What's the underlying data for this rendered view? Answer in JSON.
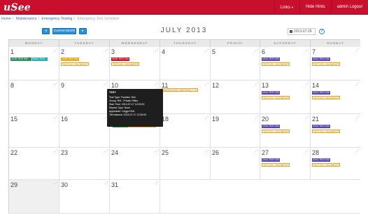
{
  "app": {
    "logo": "uSee"
  },
  "topnav": {
    "links_label": "Links",
    "hide_hints_label": "Hide Hints",
    "user_label": "admin Logout"
  },
  "breadcrumb": {
    "home": "Home",
    "maintenance": "Maintenance",
    "emergency_testing": "Emergency Testing",
    "current": "Emergency Test Schedule"
  },
  "toolbar": {
    "prev_label": "◂",
    "current_month_label": "Current Month",
    "next_label": "▸",
    "month_title": "JULY 2013",
    "date_value": "2013-07-29",
    "help_label": "?"
  },
  "weekdays": [
    "MONDAY",
    "TUESDAY",
    "WEDNESDAY",
    "THURSDAY",
    "FRIDAY",
    "SATURDAY",
    "SUNDAY"
  ],
  "days": {
    "d1": "1",
    "d2": "2",
    "d3": "3",
    "d4": "4",
    "d5": "5",
    "d6": "6",
    "d7": "7",
    "d8": "8",
    "d9": "9",
    "d10": "10",
    "d11": "11",
    "d12": "12",
    "d13": "13",
    "d14": "14",
    "d15": "15",
    "d16": "16",
    "d17": "17",
    "d18": "18",
    "d19": "19",
    "d20": "20",
    "d21": "21",
    "d22": "22",
    "d23": "23",
    "d24": "24",
    "d25": "25",
    "d26": "26",
    "d27": "27",
    "d28": "28",
    "d29": "29",
    "d30": "30",
    "d31": "31"
  },
  "events": {
    "e1a": "12:00 TEST 991",
    "e1b": "PASS TEST",
    "e2a": "12:00 TEST 004",
    "e2b": "TEST 003 : INCOMPLETE",
    "e3a": "00:00 TEST 004",
    "e3b": "TEST 004 : INCOMPLETE",
    "e6a": "19:01 TEST 002",
    "e6b": "TEST 002 : INCOMPLETE",
    "e7a": "19:01 TEST 002",
    "e7b": "TEST 002 : INCOMPLETE",
    "e11": "WAREHOUSE EMERGENCY TEST...",
    "e13a": "19:01 TEST 002",
    "e13b": "TEST 002 : INCOMPLETE",
    "e14a": "19:01 TEST 002",
    "e14b": "TEST 002 : INCOMPLETE",
    "e17a": "12:00 TEST",
    "e17b": "TEST : INCOMPLETE",
    "e20a": "19:01 TEST 002",
    "e20b": "TEST 002 : INCOMPLETE",
    "e21a": "19:01 TEST 002",
    "e21b": "TEST 002 : INCOMPLETE",
    "e27a": "19:01 TEST 002",
    "e27b": "TEST 002 : INCOMPLETE",
    "e28a": "19:01 TEST 002",
    "e28b": "TEST 002 : INCOMPLETE"
  },
  "tooltip": {
    "title": "TEST",
    "rows": [
      "Test Type: Function Test",
      "Group: RM - Private Office",
      "Start Time: 2013-07-17 12:00:00",
      "Repeat Type: None",
      "Applicable: Ceggs RM1",
      "Tilt Instance: 2013-07-17 12:00:00"
    ]
  },
  "colors": {
    "brand": "#c8102e",
    "accent": "#2a8fdc"
  }
}
